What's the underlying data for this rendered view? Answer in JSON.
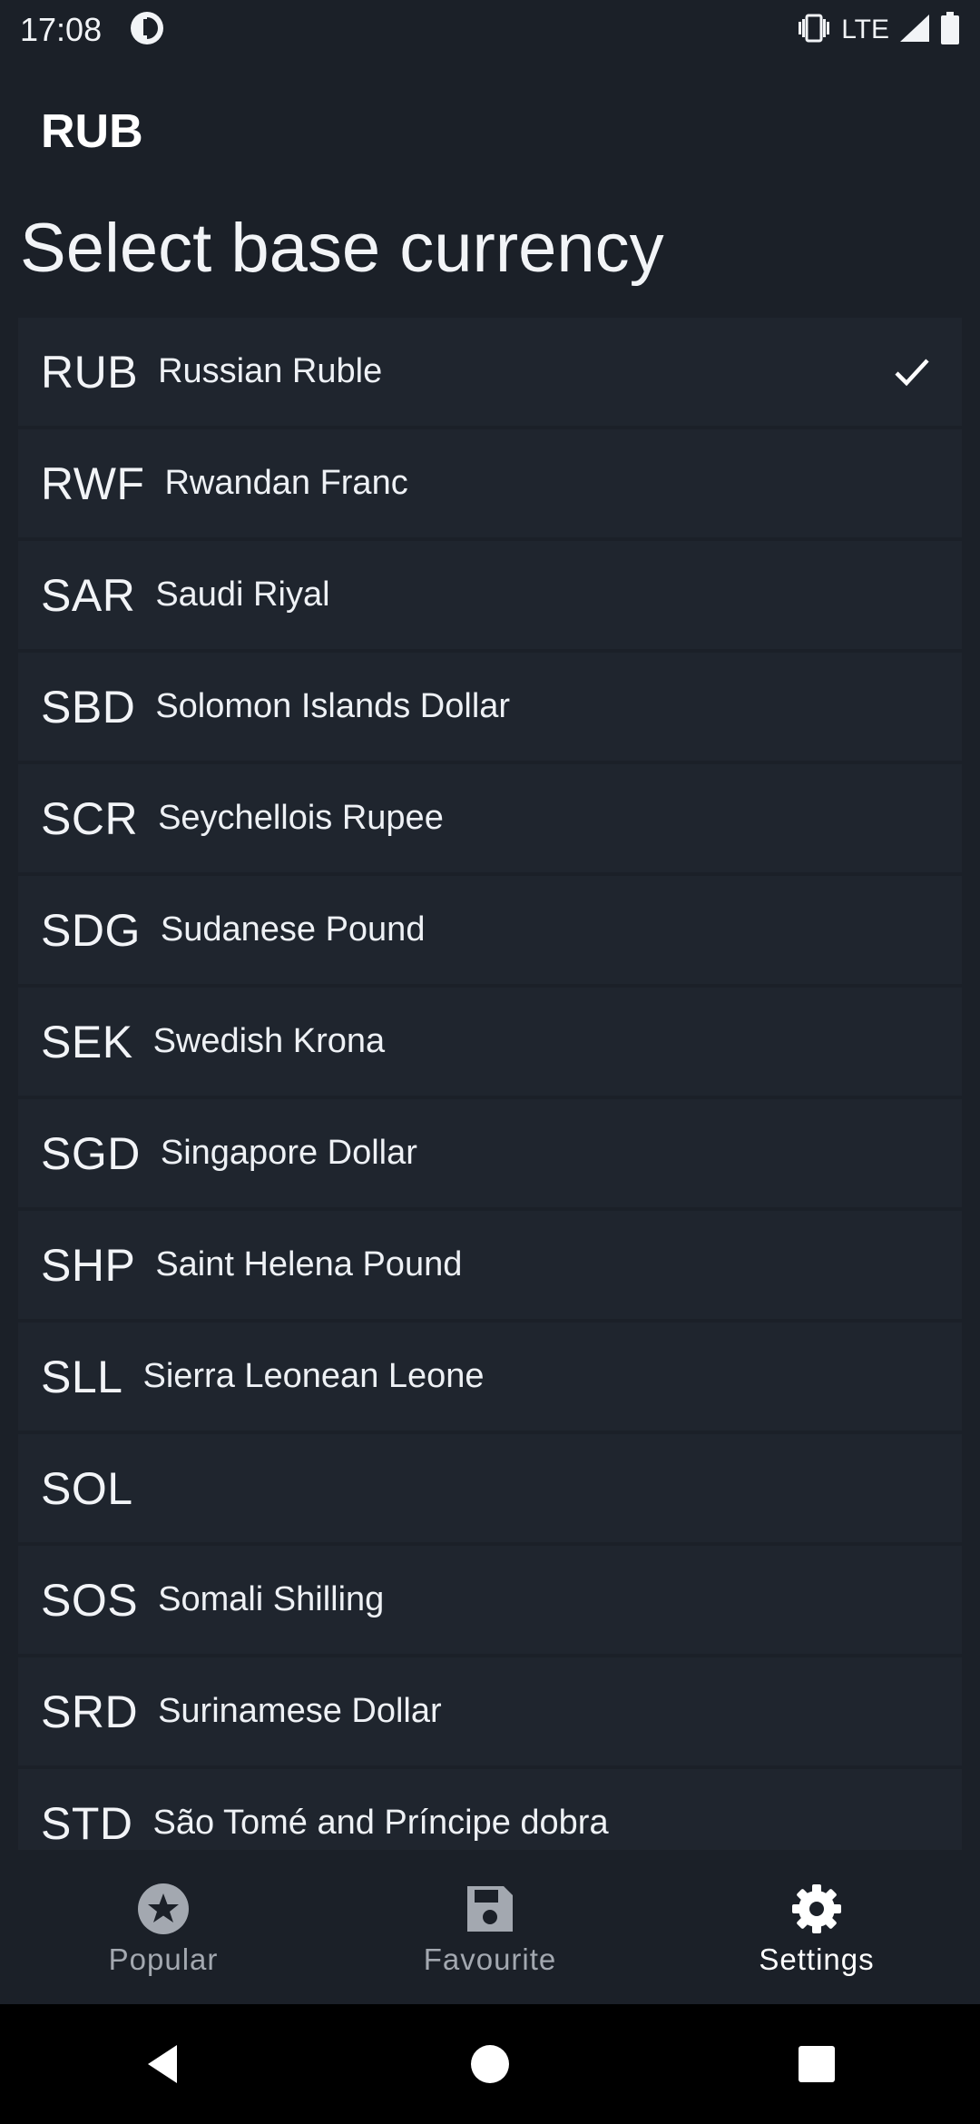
{
  "status_bar": {
    "time": "17:08",
    "network": "LTE"
  },
  "app_bar": {
    "title": "RUB"
  },
  "page_title": "Select base currency",
  "currencies": [
    {
      "code": "RUB",
      "name": "Russian Ruble",
      "selected": true
    },
    {
      "code": "RWF",
      "name": "Rwandan Franc",
      "selected": false
    },
    {
      "code": "SAR",
      "name": "Saudi Riyal",
      "selected": false
    },
    {
      "code": "SBD",
      "name": "Solomon Islands Dollar",
      "selected": false
    },
    {
      "code": "SCR",
      "name": "Seychellois Rupee",
      "selected": false
    },
    {
      "code": "SDG",
      "name": "Sudanese Pound",
      "selected": false
    },
    {
      "code": "SEK",
      "name": "Swedish Krona",
      "selected": false
    },
    {
      "code": "SGD",
      "name": "Singapore Dollar",
      "selected": false
    },
    {
      "code": "SHP",
      "name": "Saint Helena Pound",
      "selected": false
    },
    {
      "code": "SLL",
      "name": "Sierra Leonean Leone",
      "selected": false
    },
    {
      "code": "SOL",
      "name": "",
      "selected": false
    },
    {
      "code": "SOS",
      "name": "Somali Shilling",
      "selected": false
    },
    {
      "code": "SRD",
      "name": "Surinamese Dollar",
      "selected": false
    },
    {
      "code": "STD",
      "name": "São Tomé and Príncipe dobra",
      "selected": false
    }
  ],
  "bottom_nav": {
    "items": [
      {
        "label": "Popular",
        "icon": "star-icon",
        "active": false
      },
      {
        "label": "Favourite",
        "icon": "save-icon",
        "active": false
      },
      {
        "label": "Settings",
        "icon": "gear-icon",
        "active": true
      }
    ]
  },
  "colors": {
    "background": "#1b2028",
    "row": "#1f252e",
    "inactive": "#a3a8b0",
    "active": "#ffffff"
  }
}
